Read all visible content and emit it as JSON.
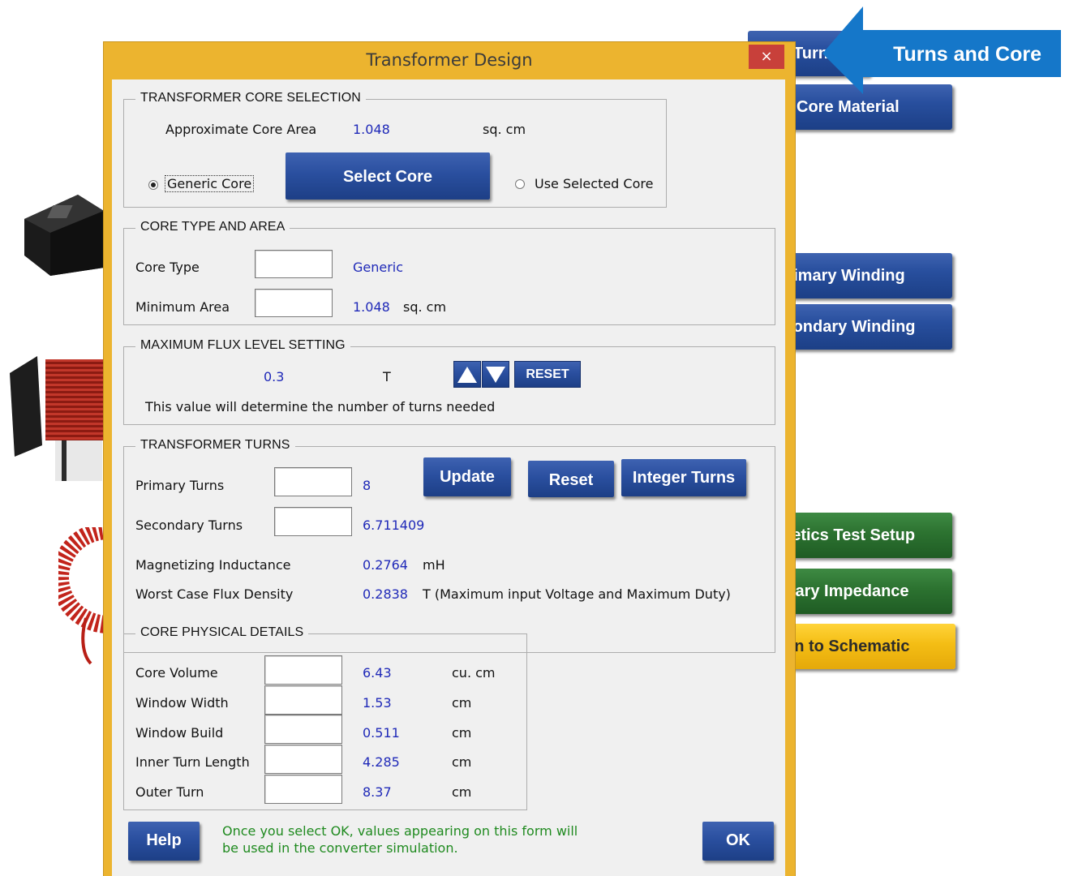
{
  "sheet_buttons": [
    {
      "id": "turns",
      "label": "Turns and Core",
      "color": "#2a4f9f"
    },
    {
      "id": "core-material",
      "label": "Core Material",
      "color": "#2a4f9f"
    },
    {
      "id": "primary-winding",
      "label": "Primary Winding",
      "color": "#2a4f9f"
    },
    {
      "id": "secondary-winding",
      "label": "Secondary Winding",
      "color": "#2a4f9f"
    },
    {
      "id": "magnetics-test-setup",
      "label": "Magnetics Test Setup",
      "color": "#2c7230"
    },
    {
      "id": "primary-impedance",
      "label": "Primary Impedance",
      "color": "#2c7230"
    },
    {
      "id": "return-to-schematic",
      "label": "Return to Schematic",
      "color": "#f4bd14"
    }
  ],
  "callout": {
    "text": "Turns and Core",
    "color": "#1577c9"
  },
  "dialog": {
    "title": "Transformer Design",
    "close_label": "×",
    "core_selection": {
      "heading": "TRANSFORMER CORE SELECTION",
      "approx_area_label": "Approximate Core Area",
      "approx_area_value": "1.048",
      "approx_area_unit": "sq. cm",
      "generic_core_label": "Generic Core",
      "select_core_label": "Select Core",
      "use_selected_label": "Use Selected Core",
      "selected_option": "Generic Core"
    },
    "core_type": {
      "heading": "CORE TYPE AND AREA",
      "core_type_label": "Core Type",
      "core_type_value": "Generic",
      "min_area_label": "Minimum Area",
      "min_area_value": "1.048",
      "min_area_unit": "sq. cm"
    },
    "flux": {
      "heading": "MAXIMUM FLUX LEVEL SETTING",
      "value": "0.3",
      "unit": "T",
      "reset_label": "RESET",
      "note": "This value will determine the number of turns needed"
    },
    "turns": {
      "heading": "TRANSFORMER TURNS",
      "primary_label": "Primary Turns",
      "primary_value": "8",
      "secondary_label": "Secondary Turns",
      "secondary_value": "6.711409",
      "update_label": "Update",
      "reset_label": "Reset",
      "integer_label": "Integer Turns",
      "inductance_label": "Magnetizing Inductance",
      "inductance_value": "0.2764",
      "inductance_unit": "mH",
      "flux_density_label": "Worst Case Flux Density",
      "flux_density_value": "0.2838",
      "flux_density_unit": "T (Maximum input Voltage and Maximum Duty)"
    },
    "physical": {
      "heading": "CORE PHYSICAL DETAILS",
      "rows": [
        {
          "label": "Core Volume",
          "value": "6.43",
          "unit": "cu. cm"
        },
        {
          "label": "Window Width",
          "value": "1.53",
          "unit": "cm"
        },
        {
          "label": "Window Build",
          "value": "0.511",
          "unit": "cm"
        },
        {
          "label": "Inner Turn Length",
          "value": "4.285",
          "unit": "cm"
        },
        {
          "label": "Outer Turn",
          "value": "8.37",
          "unit": "cm"
        }
      ]
    },
    "help_label": "Help",
    "ok_label": "OK",
    "footer_note_1": "Once you select OK, values appearing on this form will",
    "footer_note_2": "be used in the converter simulation."
  }
}
